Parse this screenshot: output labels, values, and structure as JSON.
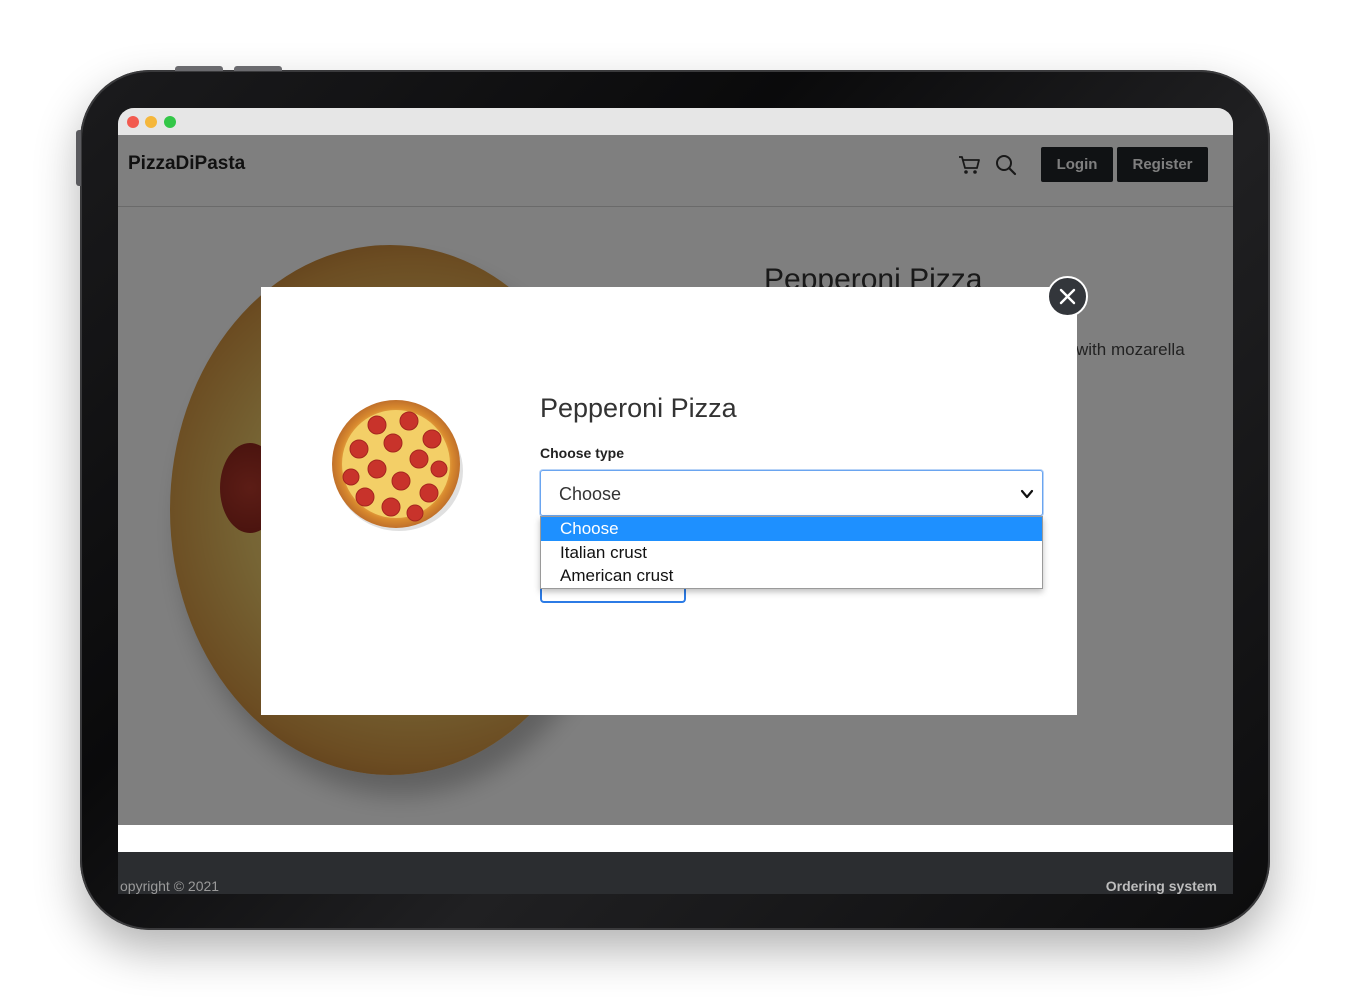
{
  "window": {
    "controls": [
      "close",
      "minimize",
      "maximize"
    ]
  },
  "navbar": {
    "brand": "PizzaDiPasta",
    "cart_icon": "cart-icon",
    "search_icon": "search-icon",
    "login_label": "Login",
    "register_label": "Register"
  },
  "background_page": {
    "product_title": "Pepperoni Pizza",
    "description_fragment": "with mozarella"
  },
  "modal": {
    "title": "Pepperoni Pizza",
    "choose_label": "Choose type",
    "select_value": "Choose",
    "options": [
      {
        "label": "Choose",
        "selected": true
      },
      {
        "label": "Italian crust",
        "selected": false
      },
      {
        "label": "American crust",
        "selected": false
      }
    ],
    "close_icon": "close-icon"
  },
  "footer": {
    "copyright": "opyright © 2021",
    "right_text": "Ordering system"
  },
  "colors": {
    "accent_blue": "#1e90ff",
    "dark_button": "#212529",
    "overlay": "rgba(0,0,0,0.5)"
  }
}
